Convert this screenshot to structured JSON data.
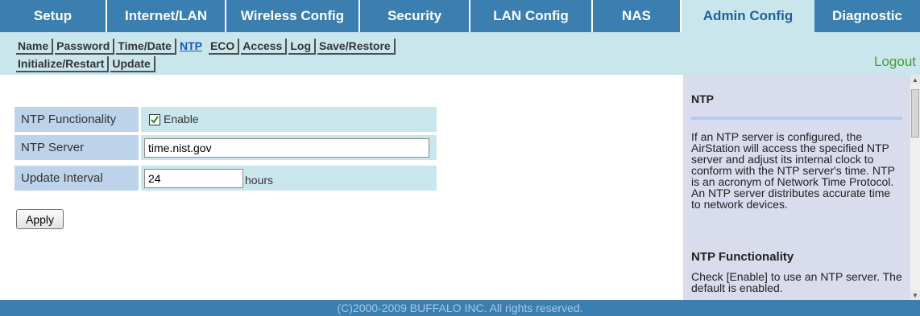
{
  "top_tabs": [
    {
      "label": "Setup"
    },
    {
      "label": "Internet/LAN"
    },
    {
      "label": "Wireless Config"
    },
    {
      "label": "Security"
    },
    {
      "label": "LAN Config"
    },
    {
      "label": "NAS"
    },
    {
      "label": "Admin Config",
      "active": true
    },
    {
      "label": "Diagnostic"
    }
  ],
  "sub_tabs_row1": [
    "Name",
    "Password",
    "Time/Date",
    "NTP",
    "ECO",
    "Access",
    "Log",
    "Save/Restore"
  ],
  "sub_tabs_row2": [
    "Initialize/Restart",
    "Update"
  ],
  "active_sub_tab": "NTP",
  "logout_label": "Logout",
  "form": {
    "ntp_functionality": {
      "label": "NTP Functionality",
      "checkbox_label": "Enable",
      "checked": true
    },
    "ntp_server": {
      "label": "NTP Server",
      "value": "time.nist.gov"
    },
    "update_interval": {
      "label": "Update Interval",
      "value": "24",
      "unit": "hours"
    }
  },
  "apply_label": "Apply",
  "help": {
    "title": "NTP",
    "text": "If an NTP server is configured, the AirStation will access the specified NTP server and adjust its internal clock to conform with the NTP server's time. NTP is an acronym of Network Time Protocol. An NTP server distributes accurate time to network devices.",
    "subtitle": "NTP Functionality",
    "text2": "Check [Enable] to use an NTP server. The default is enabled."
  },
  "footer": "(C)2000-2009 BUFFALO INC. All rights reserved.",
  "colors": {
    "tab_blue": "#3b7fb0",
    "light_cyan": "#c9e6ed",
    "label_blue": "#bcd3ea",
    "help_bg": "#d9dcec",
    "logout_green": "#44a02c"
  }
}
